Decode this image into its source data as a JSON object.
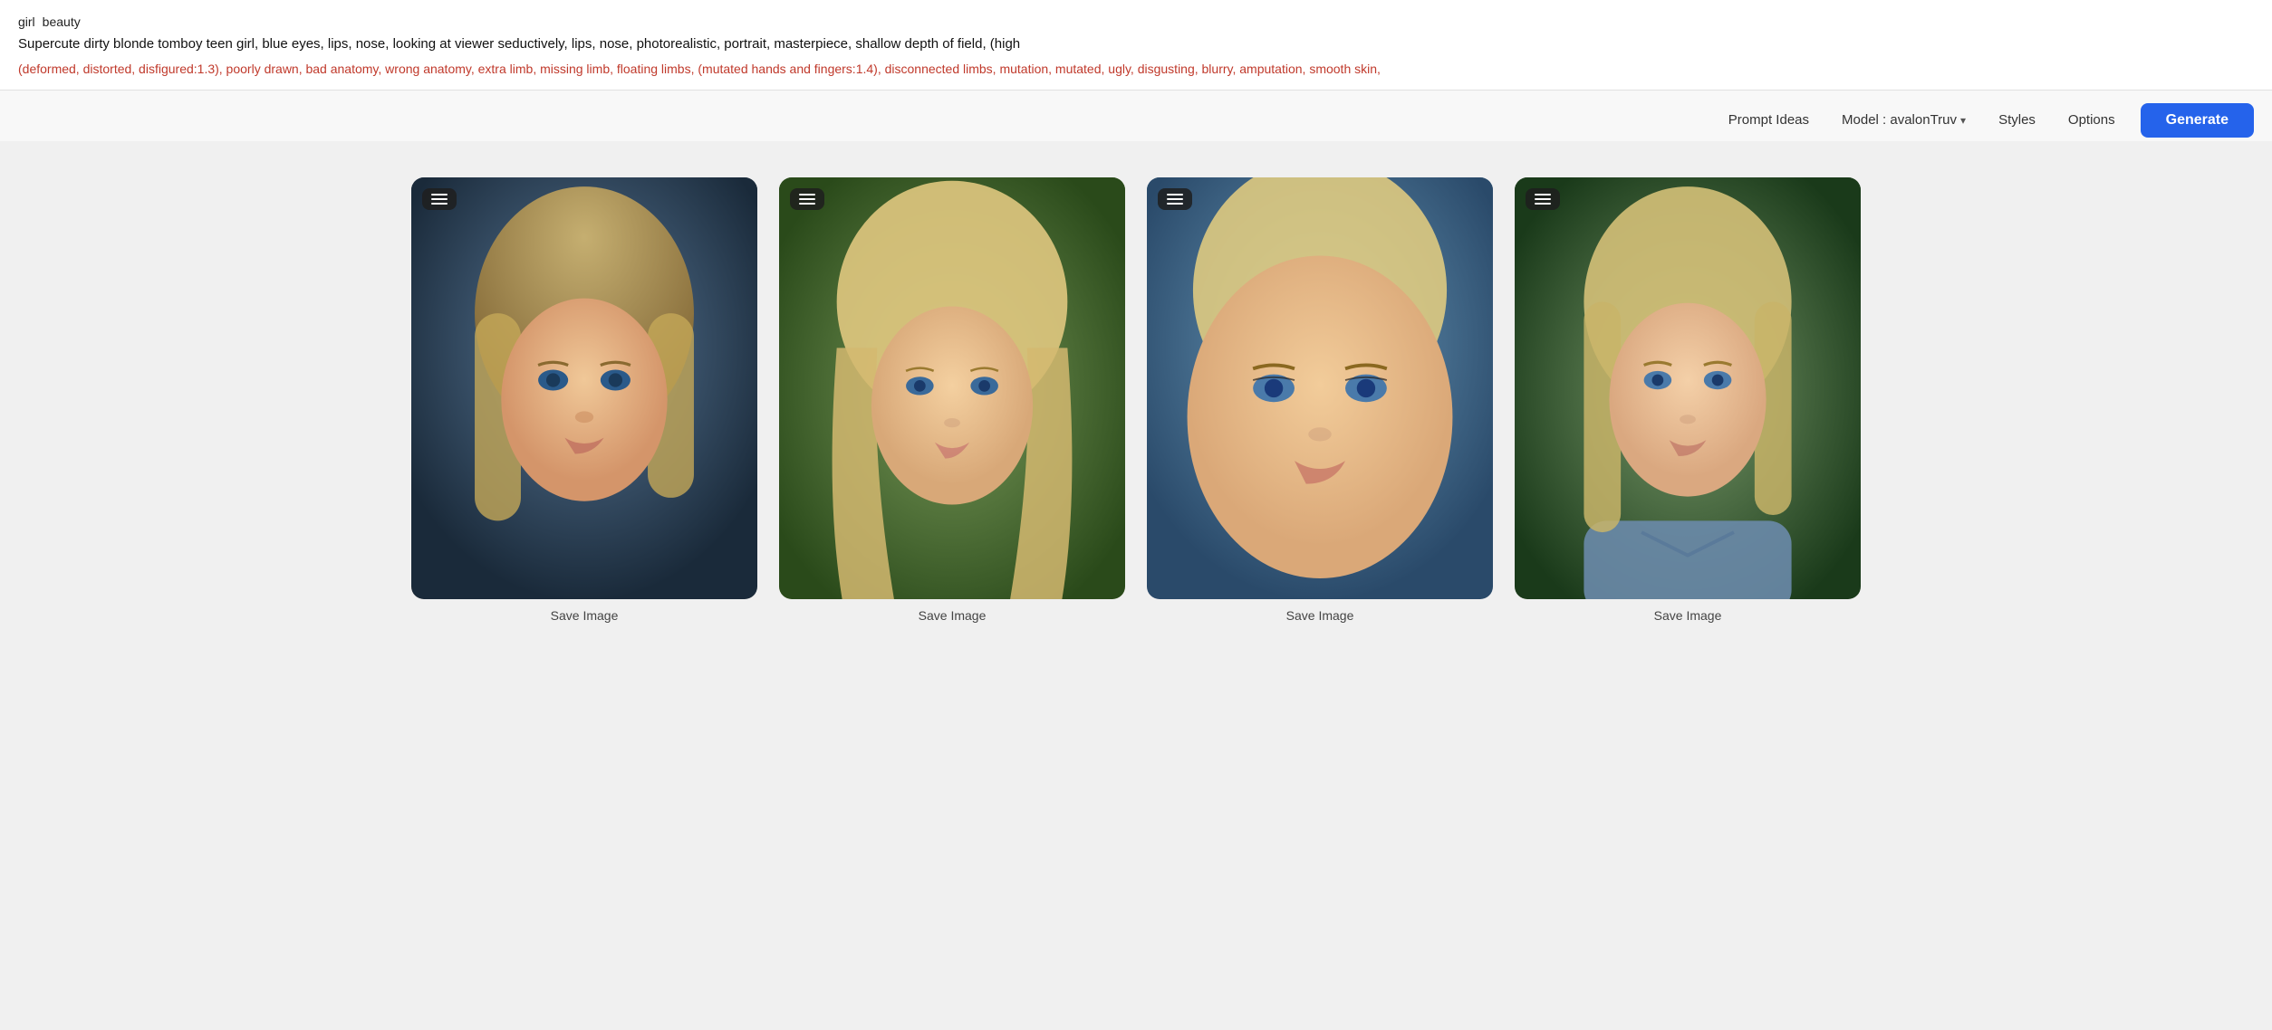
{
  "prompt": {
    "tags": [
      "girl",
      "beauty"
    ],
    "positive_text": "Supercute dirty blonde tomboy teen girl, blue eyes, lips, nose, looking at viewer seductively, lips, nose, photorealistic, portrait, masterpiece, shallow depth of field, (high",
    "negative_text": "(deformed, distorted, disfigured:1.3), poorly drawn, bad anatomy, wrong anatomy, extra limb, missing limb, floating limbs, (mutated hands and fingers:1.4), disconnected limbs, mutation, mutated, ugly, disgusting, blurry, amputation, smooth skin,"
  },
  "toolbar": {
    "prompt_ideas_label": "Prompt Ideas",
    "model_label": "Model : avalonTruv",
    "styles_label": "Styles",
    "options_label": "Options",
    "generate_label": "Generate"
  },
  "images": [
    {
      "id": 1,
      "save_label": "Save Image",
      "bg_class": "img1"
    },
    {
      "id": 2,
      "save_label": "Save Image",
      "bg_class": "img2"
    },
    {
      "id": 3,
      "save_label": "Save Image",
      "bg_class": "img3"
    },
    {
      "id": 4,
      "save_label": "Save Image",
      "bg_class": "img4"
    }
  ],
  "icons": {
    "menu": "≡",
    "chevron_down": "▾"
  }
}
